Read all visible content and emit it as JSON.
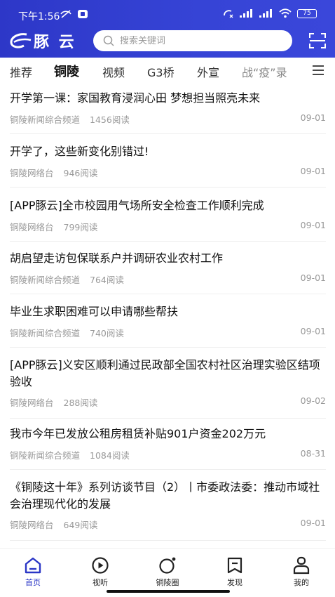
{
  "status": {
    "time": "下午1:56",
    "battery": "75"
  },
  "app": {
    "name": "豚 云"
  },
  "search": {
    "placeholder": "搜索关键词"
  },
  "tabs": [
    "推荐",
    "铜陵",
    "视频",
    "G3桥",
    "外宣",
    "战“疫”录"
  ],
  "active_tab": "铜陵",
  "articles": [
    {
      "title": "开学第一课：家国教育浸润心田 梦想担当照亮未来",
      "source": "铜陵新闻综合频道",
      "reads": "1456阅读",
      "date": "09-01"
    },
    {
      "title": "开学了，这些新变化别错过!",
      "source": "铜陵网络台",
      "reads": "946阅读",
      "date": "09-01"
    },
    {
      "title": "[APP豚云]全市校园用气场所安全检查工作顺利完成",
      "source": "铜陵网络台",
      "reads": "799阅读",
      "date": "09-01"
    },
    {
      "title": "胡启望走访包保联系户并调研农业农村工作",
      "source": "铜陵新闻综合频道",
      "reads": "764阅读",
      "date": "09-01"
    },
    {
      "title": "毕业生求职困难可以申请哪些帮扶",
      "source": "铜陵新闻综合频道",
      "reads": "740阅读",
      "date": "09-01"
    },
    {
      "title": "[APP豚云]义安区顺利通过民政部全国农村社区治理实验区结项验收",
      "source": "铜陵网络台",
      "reads": "288阅读",
      "date": "09-02"
    },
    {
      "title": "我市今年已发放公租房租赁补贴901户资金202万元",
      "source": "铜陵新闻综合频道",
      "reads": "1084阅读",
      "date": "08-31"
    },
    {
      "title": "《铜陵这十年》系列访谈节目（2）丨市委政法委：推动市域社会治理现代化的发展",
      "source": "铜陵网络台",
      "reads": "649阅读",
      "date": "09-01"
    }
  ],
  "bottom_nav": [
    {
      "label": "首页",
      "icon": "home-icon"
    },
    {
      "label": "视听",
      "icon": "play-icon"
    },
    {
      "label": "铜陵圈",
      "icon": "circle-icon"
    },
    {
      "label": "发现",
      "icon": "bookmark-icon"
    },
    {
      "label": "我的",
      "icon": "user-icon"
    }
  ],
  "colors": {
    "brand": "#2d37c8",
    "meta_text": "#999999",
    "active_nav": "#2a36c6"
  }
}
